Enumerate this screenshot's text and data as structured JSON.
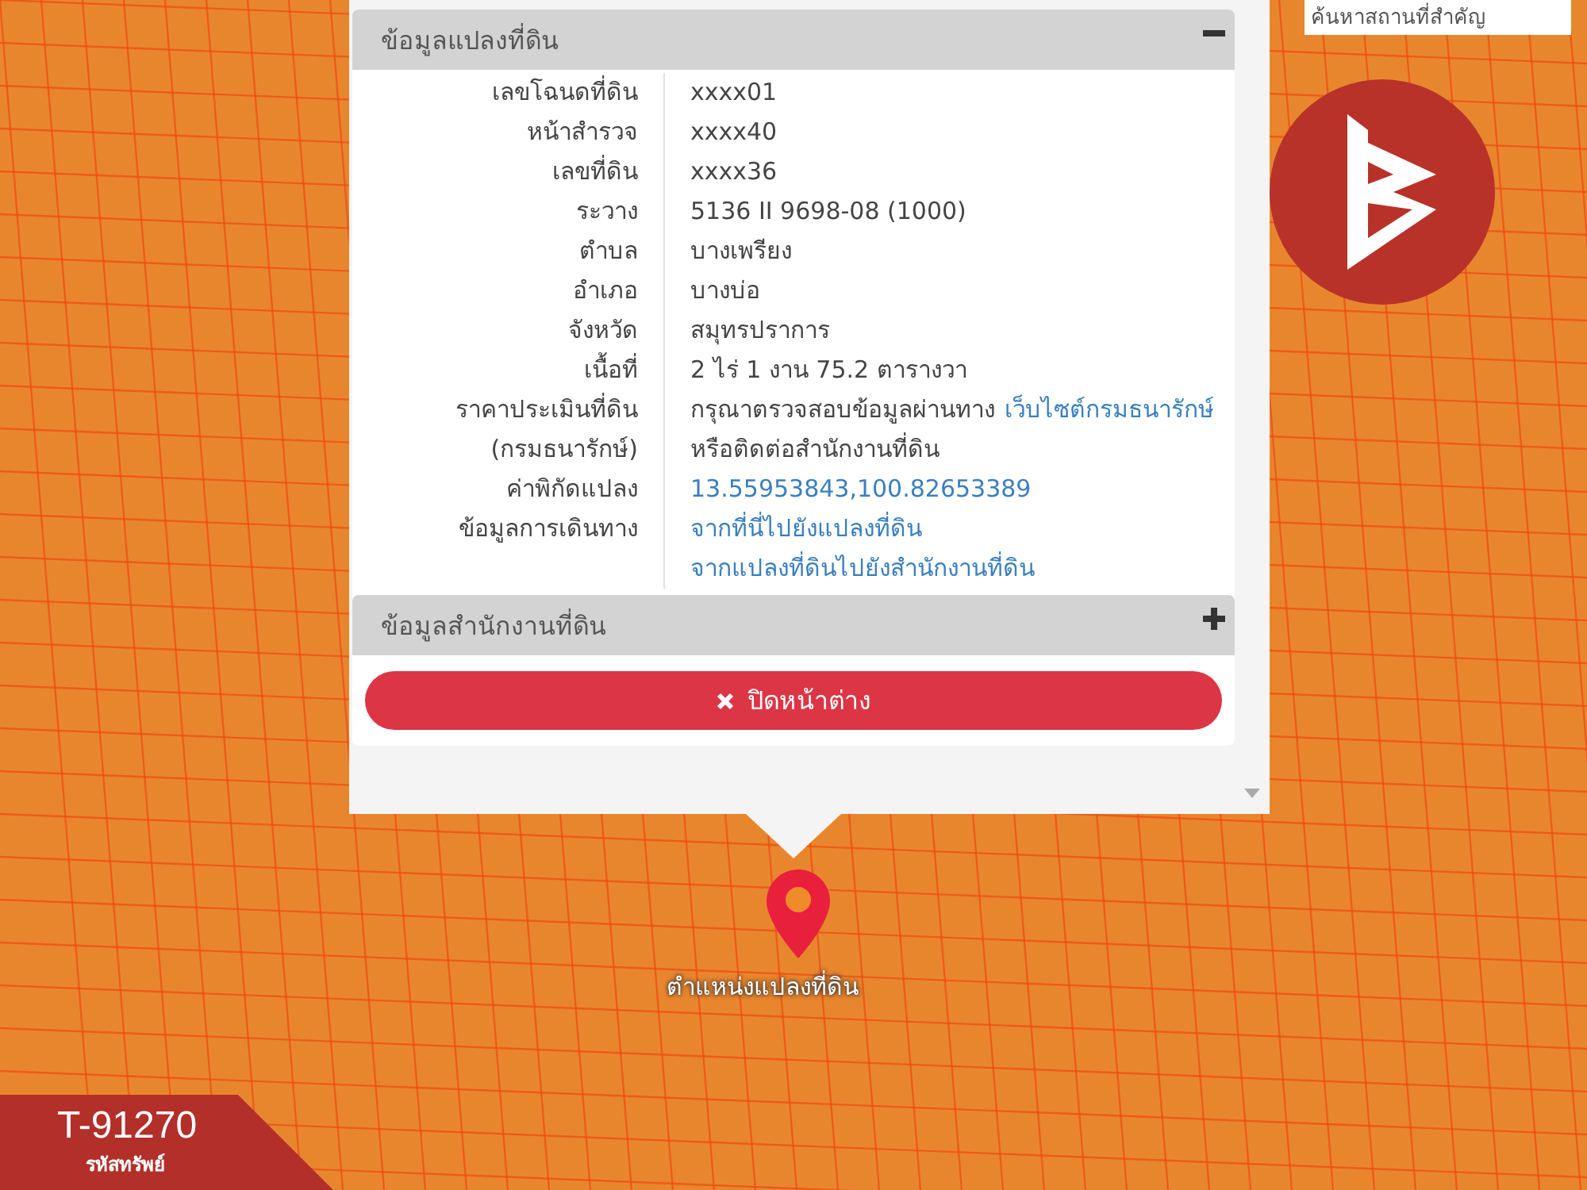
{
  "search": {
    "placeholder": "ค้นหาสถานที่สำคัญ"
  },
  "popup": {
    "sections": [
      {
        "title": "ข้อมูลแปลงที่ดิน",
        "expanded": true,
        "rows": [
          {
            "label": "เลขโฉนดที่ดิน",
            "parts": [
              {
                "text": "xxxx01",
                "kind": "text"
              }
            ]
          },
          {
            "label": "หน้าสำรวจ",
            "parts": [
              {
                "text": "xxxx40",
                "kind": "text"
              }
            ]
          },
          {
            "label": "เลขที่ดิน",
            "parts": [
              {
                "text": "xxxx36",
                "kind": "text"
              }
            ]
          },
          {
            "label": "ระวาง",
            "parts": [
              {
                "text": "5136 II 9698-08 (1000)",
                "kind": "text"
              }
            ]
          },
          {
            "label": "ตำบล",
            "parts": [
              {
                "text": "บางเพรียง",
                "kind": "text"
              }
            ]
          },
          {
            "label": "อำเภอ",
            "parts": [
              {
                "text": "บางบ่อ",
                "kind": "text"
              }
            ]
          },
          {
            "label": "จังหวัด",
            "parts": [
              {
                "text": "สมุทรปราการ",
                "kind": "text"
              }
            ]
          },
          {
            "label": "เนื้อที่",
            "parts": [
              {
                "text": "2 ไร่ 1 งาน 75.2 ตารางวา",
                "kind": "text"
              }
            ]
          },
          {
            "label": "ราคาประเมินที่ดิน",
            "parts": [
              {
                "text": "กรุณาตรวจสอบข้อมูลผ่านทาง",
                "kind": "text"
              },
              {
                "text": "เว็บไซต์กรมธนารักษ์",
                "kind": "link"
              }
            ]
          },
          {
            "label": "(กรมธนารักษ์)",
            "parts": [
              {
                "text": "หรือติดต่อสำนักงานที่ดิน",
                "kind": "text"
              }
            ]
          },
          {
            "label": "ค่าพิกัดแปลง",
            "parts": [
              {
                "text": "13.55953843,100.82653389",
                "kind": "link"
              }
            ]
          },
          {
            "label": "ข้อมูลการเดินทาง",
            "parts": [
              {
                "text": "จากที่นี่ไปยังแปลงที่ดิน",
                "kind": "link"
              }
            ]
          },
          {
            "parts": [
              {
                "text": "จากแปลงที่ดินไปยังสำนักงานที่ดิน",
                "kind": "link"
              }
            ]
          }
        ]
      },
      {
        "title": "ข้อมูลสำนักงานที่ดิน",
        "expanded": false
      }
    ],
    "close_button": "ปิดหน้าต่าง"
  },
  "marker": {
    "label": "ตำแหน่งแปลงที่ดิน"
  },
  "property_code": {
    "code": "T-91270",
    "caption": "รหัสทรัพย์"
  }
}
